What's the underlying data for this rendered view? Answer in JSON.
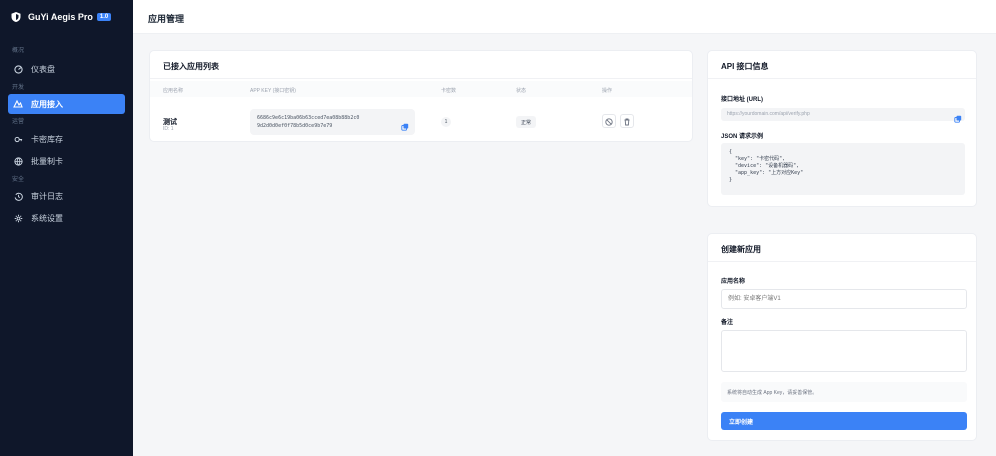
{
  "brand": {
    "name": "GuYi Aegis Pro",
    "badge": "1.0"
  },
  "nav": {
    "groups": [
      "概况",
      "开发",
      "运营",
      "安全"
    ],
    "items": [
      {
        "label": "仪表盘",
        "icon": "dashboard-icon"
      },
      {
        "label": "应用接入",
        "icon": "apps-icon",
        "active": true
      },
      {
        "label": "卡密库存",
        "icon": "key-icon"
      },
      {
        "label": "批量制卡",
        "icon": "globe-icon"
      },
      {
        "label": "审计日志",
        "icon": "history-icon"
      },
      {
        "label": "系统设置",
        "icon": "gear-icon"
      }
    ]
  },
  "header": {
    "title": "应用管理"
  },
  "apps_card": {
    "title": "已接入应用列表",
    "columns": [
      "应用名称",
      "APP KEY (接口密钥)",
      "卡密数",
      "状态",
      "操作"
    ],
    "rows": [
      {
        "name": "测试",
        "id": "ID: 1",
        "app_key_line1": "6686c9e6c19ba06b63cced7ea08b88b2c0",
        "app_key_line2": "9d2d0d0ef0f78b5d0ce9b7e79",
        "count": "1",
        "status": "正常"
      }
    ]
  },
  "api_card": {
    "title": "API 接口信息",
    "url_label": "接口地址 (URL)",
    "url_value": "https://yourdomain.com/api/verify.php",
    "json_label": "JSON 请求示例",
    "json_example": "{\n  \"key\": \"卡密代码\",\n  \"device\": \"设备机器码\",\n  \"app_key\": \"上方对应Key\"\n}"
  },
  "create_card": {
    "title": "创建新应用",
    "name_label": "应用名称",
    "name_placeholder": "例如: 安卓客户端V1",
    "note_label": "备注",
    "notice": "系统将自动生成 App Key，请妥善保管。",
    "submit_label": "立即创建"
  },
  "colors": {
    "sidebar": "#0f172a",
    "accent": "#3b82f6",
    "background": "#f5f6f8"
  }
}
